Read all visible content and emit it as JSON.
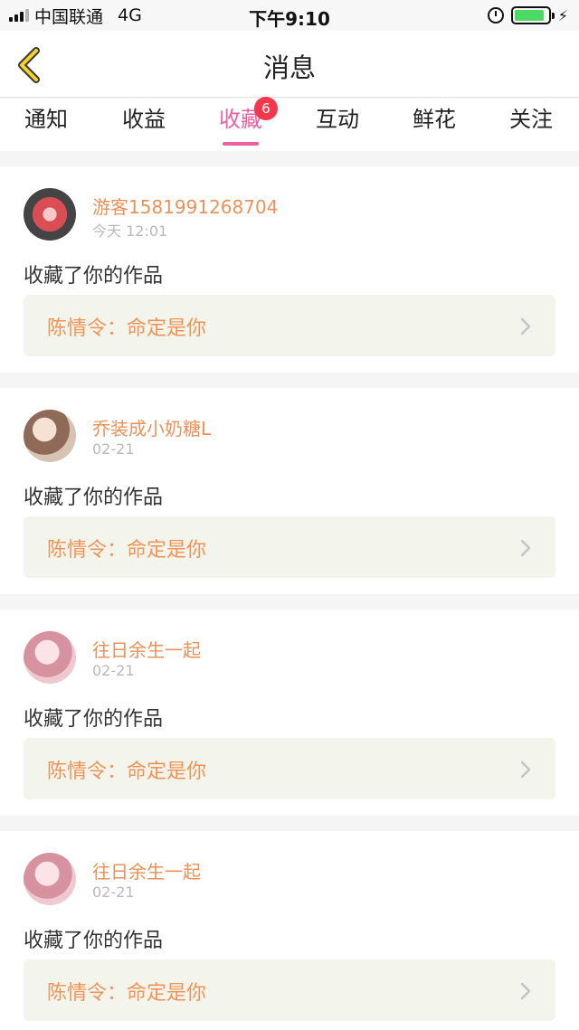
{
  "status_bar": {
    "carrier": "中国联通",
    "network": "4G",
    "time": "下午9:10",
    "battery_level": 0.9
  },
  "header": {
    "title": "消息",
    "back_icon": "chevron-left-icon"
  },
  "tabs": [
    {
      "label": "通知"
    },
    {
      "label": "收益"
    },
    {
      "label": "收藏",
      "active": true,
      "badge": "6"
    },
    {
      "label": "互动"
    },
    {
      "label": "鲜花"
    },
    {
      "label": "关注"
    }
  ],
  "messages": [
    {
      "username": "游客1581991268704",
      "time": "今天 12:01",
      "action": "收藏了你的作品",
      "work": "陈情令：命定是你"
    },
    {
      "username": "乔装成小奶糖L",
      "time": "02-21",
      "action": "收藏了你的作品",
      "work": "陈情令：命定是你"
    },
    {
      "username": "往日余生一起",
      "time": "02-21",
      "action": "收藏了你的作品",
      "work": "陈情令：命定是你"
    },
    {
      "username": "往日余生一起",
      "time": "02-21",
      "action": "收藏了你的作品",
      "work": "陈情令：命定是你"
    }
  ],
  "colors": {
    "accent": "#ee5f9f",
    "badge": "#f2384a",
    "username": "#eb915a",
    "work_title": "#ef9457",
    "work_bg": "#f3f4ec"
  }
}
